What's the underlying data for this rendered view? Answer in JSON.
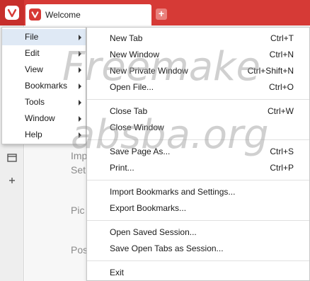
{
  "tabbar": {
    "tab_title": "Welcome",
    "new_tab_symbol": "+"
  },
  "background_page": {
    "lines": [
      "Imp",
      "Set",
      "Pic",
      "Pos"
    ]
  },
  "main_menu": {
    "items": [
      {
        "label": "File",
        "active": true,
        "has_submenu": true
      },
      {
        "label": "Edit",
        "has_submenu": true
      },
      {
        "label": "View",
        "has_submenu": true
      },
      {
        "label": "Bookmarks",
        "has_submenu": true
      },
      {
        "label": "Tools",
        "has_submenu": true
      },
      {
        "label": "Window",
        "has_submenu": true
      },
      {
        "label": "Help",
        "has_submenu": true
      }
    ]
  },
  "file_menu": {
    "groups": [
      [
        {
          "label": "New Tab",
          "shortcut": "Ctrl+T"
        },
        {
          "label": "New Window",
          "shortcut": "Ctrl+N"
        },
        {
          "label": "New Private Window",
          "shortcut": "Ctrl+Shift+N"
        },
        {
          "label": "Open File...",
          "shortcut": "Ctrl+O"
        }
      ],
      [
        {
          "label": "Close Tab",
          "shortcut": "Ctrl+W"
        },
        {
          "label": "Close Window",
          "shortcut": ""
        }
      ],
      [
        {
          "label": "Save Page As...",
          "shortcut": "Ctrl+S"
        },
        {
          "label": "Print...",
          "shortcut": "Ctrl+P"
        }
      ],
      [
        {
          "label": "Import Bookmarks and Settings...",
          "shortcut": ""
        },
        {
          "label": "Export Bookmarks...",
          "shortcut": ""
        }
      ],
      [
        {
          "label": "Open Saved Session...",
          "shortcut": ""
        },
        {
          "label": "Save Open Tabs as Session...",
          "shortcut": ""
        }
      ],
      [
        {
          "label": "Exit",
          "shortcut": ""
        }
      ]
    ]
  },
  "watermark": {
    "line1": "Freemake",
    "line2": "absba.org"
  },
  "colors": {
    "brand_red": "#d63a36",
    "menu_highlight": "#dfe9f5"
  }
}
